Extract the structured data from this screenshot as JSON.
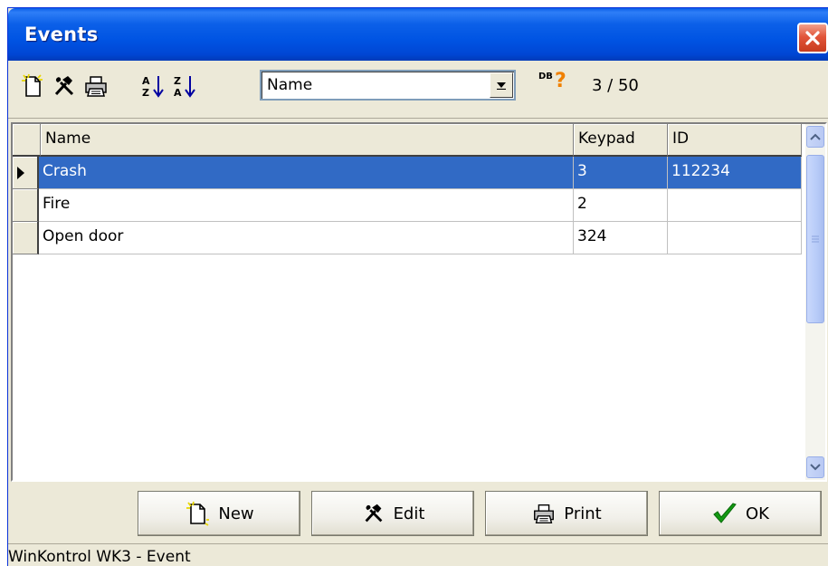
{
  "window": {
    "title": "Events",
    "status_text": "WinKontrol WK3 - Event"
  },
  "toolbar": {
    "icons": [
      "new-document-icon",
      "edit-tools-icon",
      "print-icon",
      "sort-ascending-icon",
      "sort-descending-icon"
    ],
    "sort_field": "Name",
    "db_label": "DB",
    "db_mark": "?",
    "record_counter": "3 / 50"
  },
  "grid": {
    "columns": [
      "Name",
      "Keypad",
      "ID"
    ],
    "rows": [
      {
        "name": "Crash",
        "keypad": "3",
        "id": "112234",
        "selected": true
      },
      {
        "name": "Fire",
        "keypad": "2",
        "id": ""
      },
      {
        "name": "Open door",
        "keypad": "324",
        "id": ""
      }
    ]
  },
  "buttons": {
    "new_label": "New",
    "edit_label": "Edit",
    "print_label": "Print",
    "ok_label": "OK"
  },
  "colors": {
    "title_bar": "#0054e3",
    "selection": "#316ac5",
    "close_button": "#e2553a",
    "face": "#ece9d8"
  }
}
